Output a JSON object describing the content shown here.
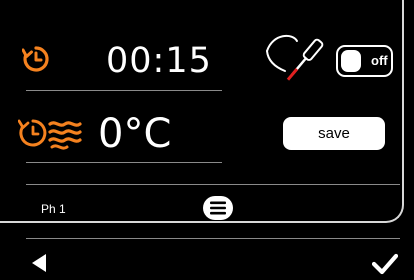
{
  "program": {
    "timer": {
      "icon": "timer-icon",
      "value": "00:15"
    },
    "temperature": {
      "icon": "heat-icon",
      "value": "0°C"
    },
    "probe": {
      "icon": "core-probe-icon",
      "toggle_label": "off",
      "enabled": false
    },
    "save_label": "save",
    "phase_label": "Ph 1",
    "menu_icon": "menu-icon"
  },
  "navigation": {
    "back_icon": "back-arrow-icon",
    "confirm_icon": "checkmark-icon"
  },
  "colors": {
    "background": "#000000",
    "accent_orange": "#f5821f",
    "text": "#ffffff",
    "divider": "#8a8a8a"
  }
}
